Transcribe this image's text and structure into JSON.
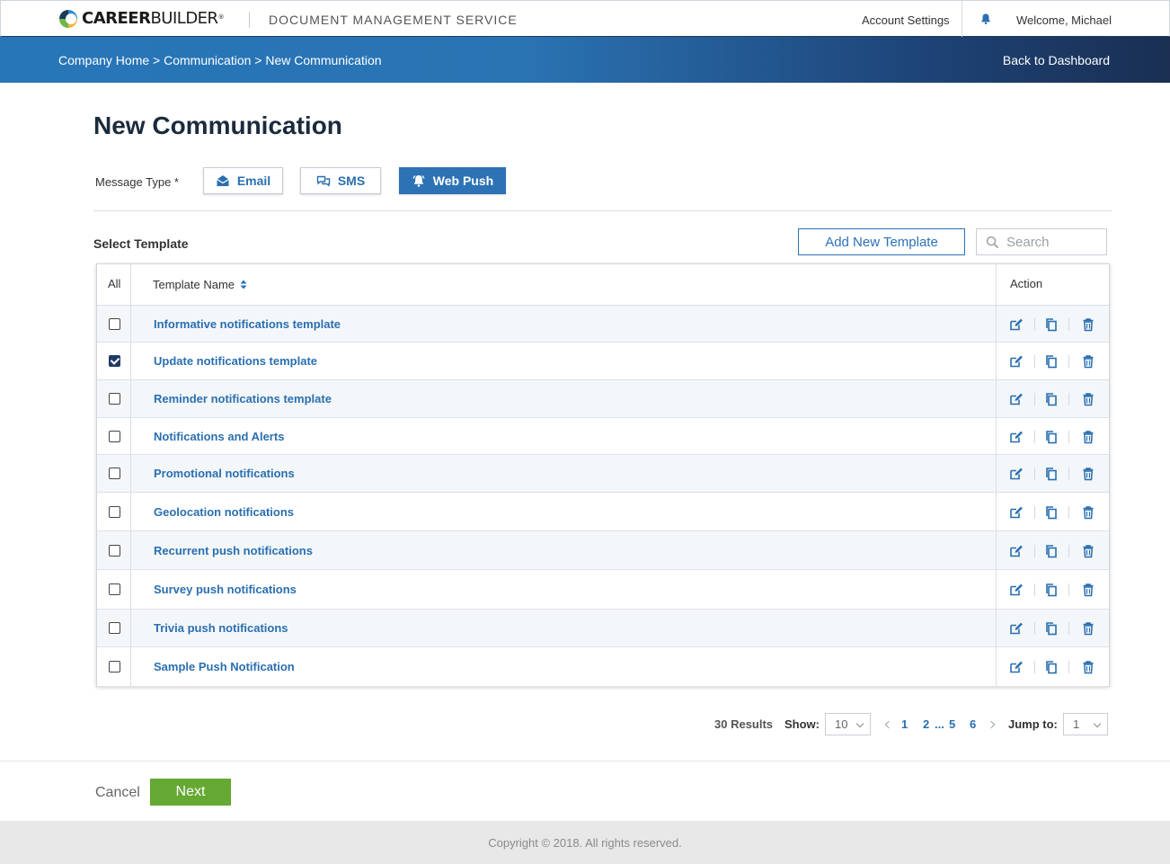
{
  "header": {
    "logo_bold": "CAREER",
    "logo_light": "BUILDER",
    "logo_reg": "®",
    "app_name": "DOCUMENT MANAGEMENT SERVICE",
    "account_settings": "Account Settings",
    "welcome": "Welcome, Michael"
  },
  "subbar": {
    "breadcrumb": [
      "Company Home",
      "Communication",
      "New Communication"
    ],
    "separator": ">",
    "back_to_dashboard": "Back to Dashboard"
  },
  "page": {
    "title": "New Communication",
    "message_type_label": "Message Type *",
    "message_types": [
      {
        "label": "Email",
        "icon": "envelope-icon",
        "active": false
      },
      {
        "label": "SMS",
        "icon": "chat-bubbles-icon",
        "active": false
      },
      {
        "label": "Web Push",
        "icon": "bell-icon",
        "active": true
      }
    ],
    "select_template_label": "Select Template",
    "add_new_template": "Add New Template",
    "search_placeholder": "Search"
  },
  "table": {
    "headers": {
      "all": "All",
      "name": "Template Name",
      "action": "Action"
    },
    "rows": [
      {
        "name": "Informative notifications template",
        "checked": false
      },
      {
        "name": "Update notifications template",
        "checked": true
      },
      {
        "name": "Reminder notifications template",
        "checked": false
      },
      {
        "name": "Notifications and Alerts",
        "checked": false
      },
      {
        "name": "Promotional notifications",
        "checked": false
      },
      {
        "name": "Geolocation notifications",
        "checked": false
      },
      {
        "name": "Recurrent push notifications",
        "checked": false
      },
      {
        "name": "Survey push notifications",
        "checked": false
      },
      {
        "name": "Trivia push notifications",
        "checked": false
      },
      {
        "name": "Sample Push Notification",
        "checked": false
      }
    ]
  },
  "pagination": {
    "results": "30 Results",
    "show_label": "Show:",
    "show_value": "10",
    "pages": [
      "1",
      "2",
      "...",
      "5",
      "6"
    ],
    "jump_label": "Jump to:",
    "jump_value": "1"
  },
  "actions": {
    "cancel": "Cancel",
    "next": "Next"
  },
  "footer": {
    "copyright": "Copyright © 2018. All rights reserved."
  },
  "colors": {
    "accent": "#2c72b5",
    "link": "#2a6fb0",
    "next": "#65a832",
    "title": "#1b2b3d"
  }
}
